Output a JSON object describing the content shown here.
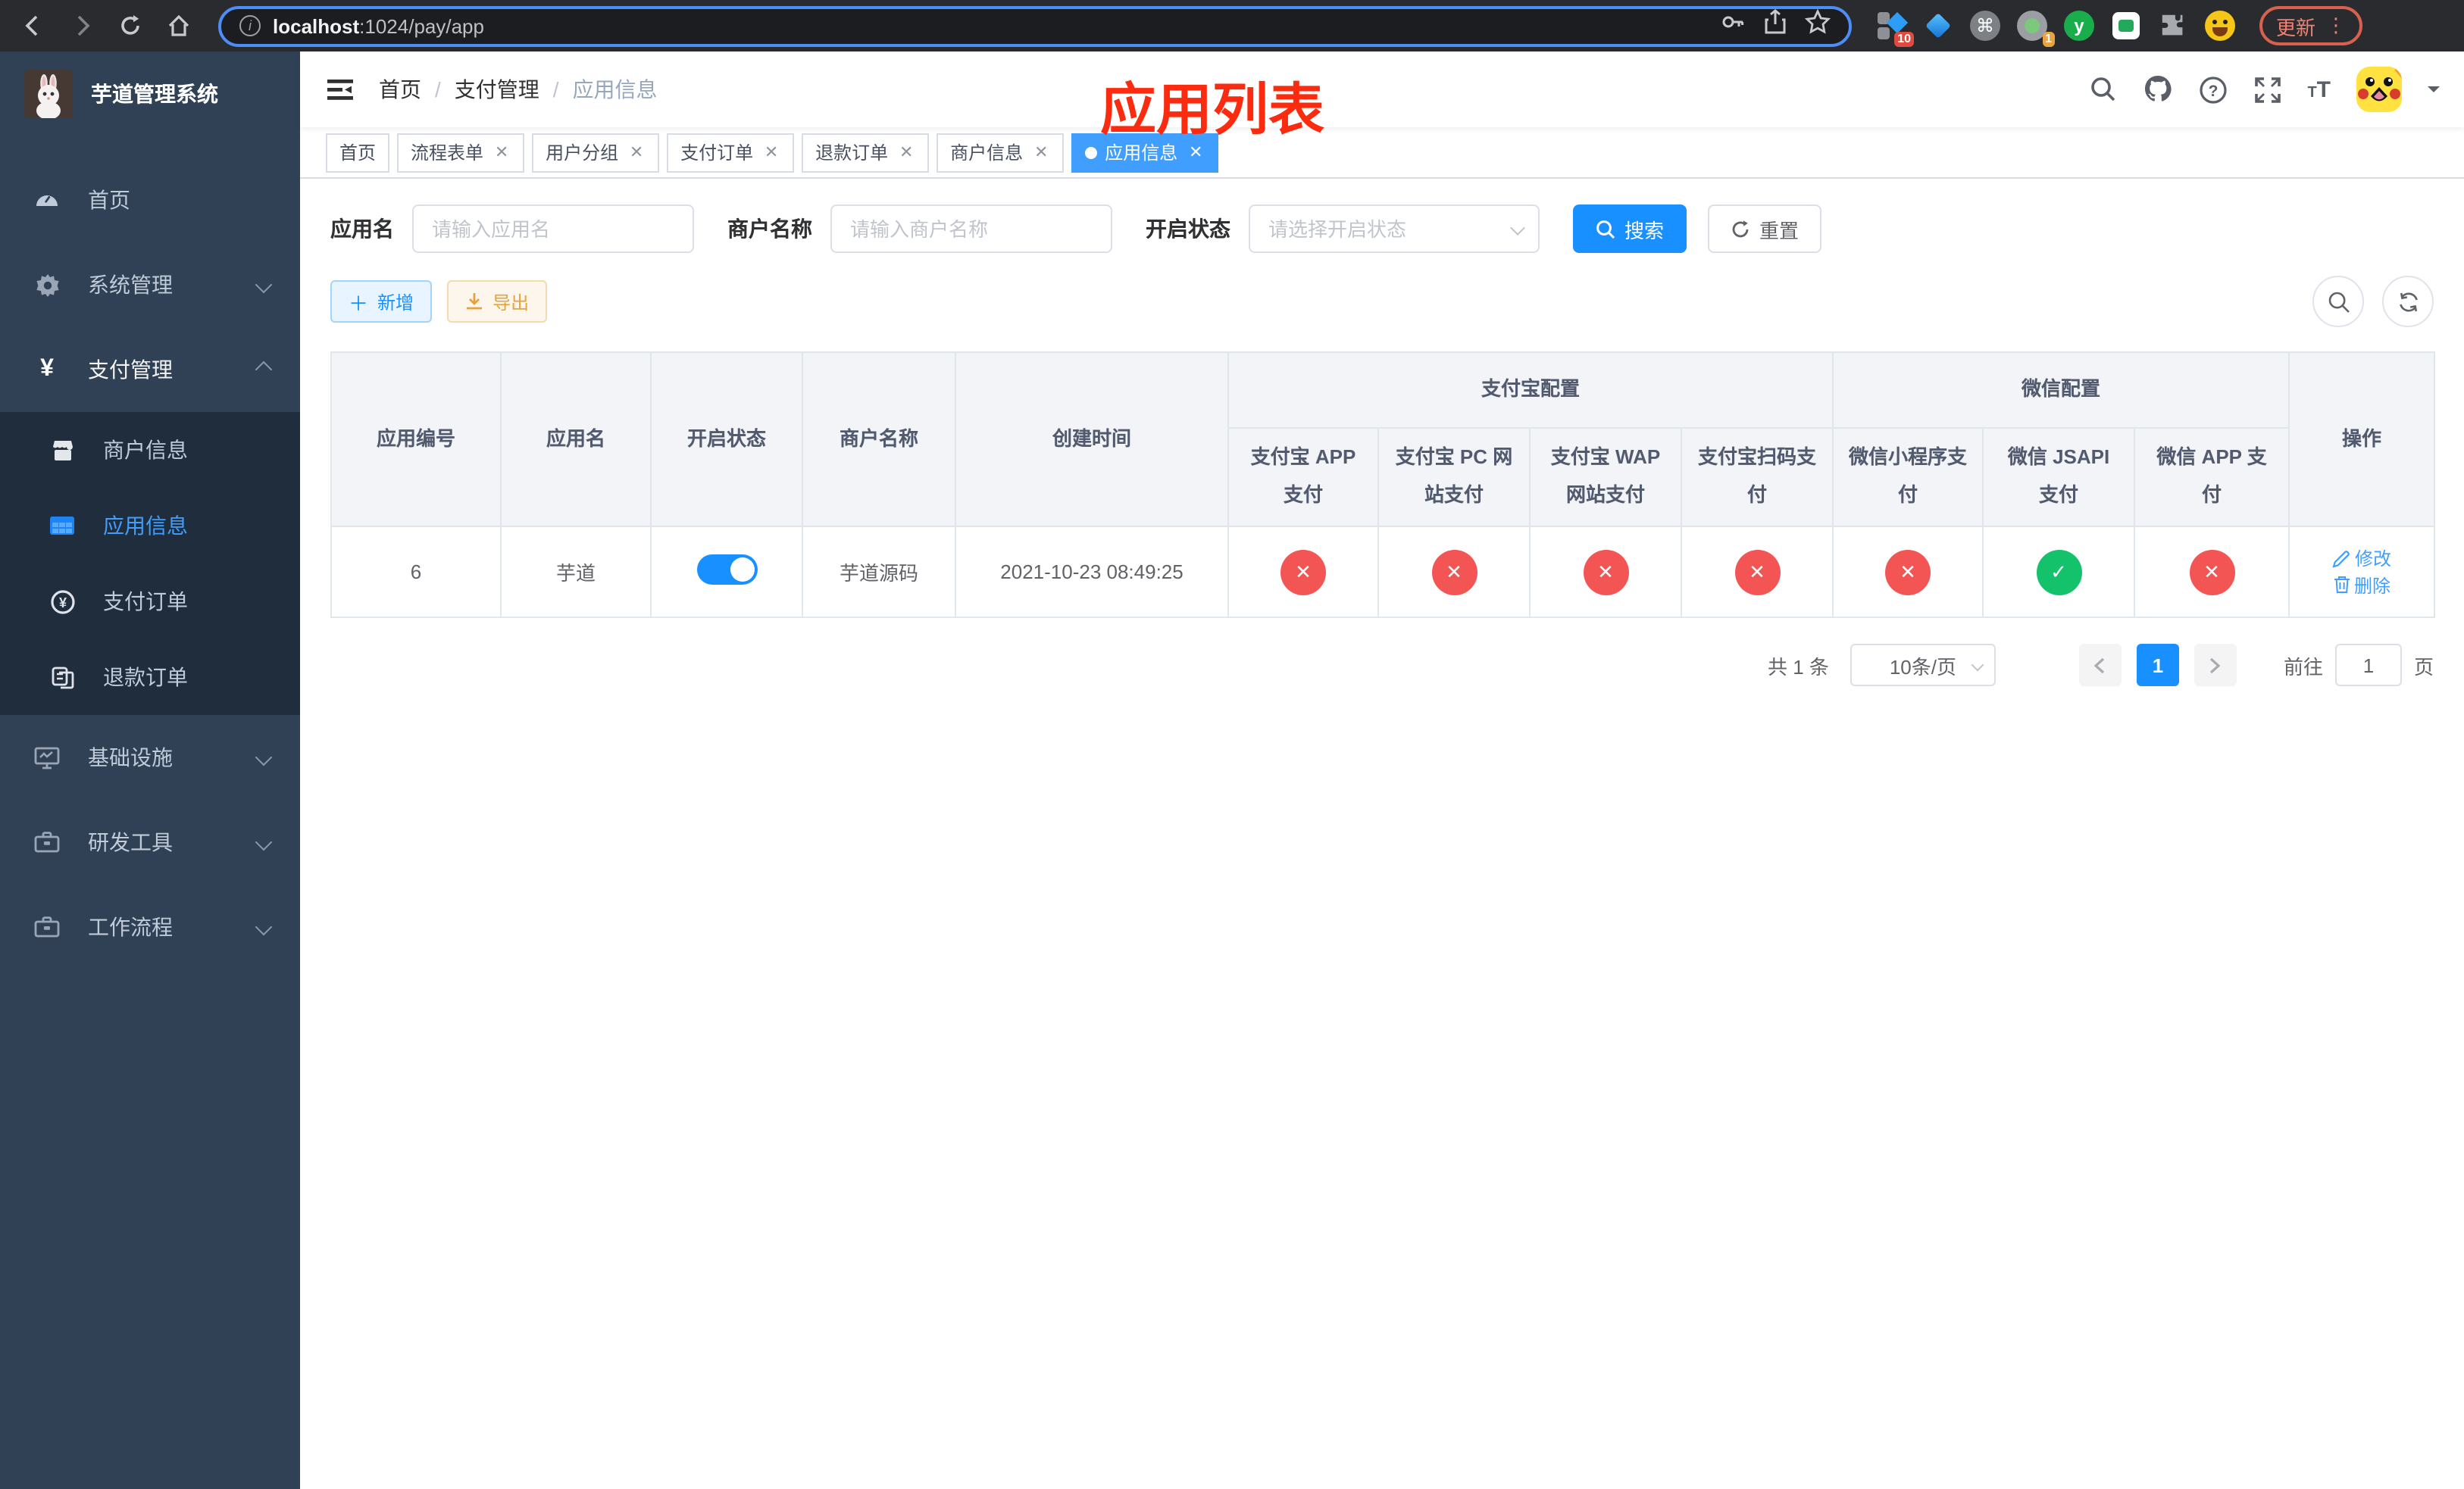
{
  "browser": {
    "url_host": "localhost",
    "url_path": ":1024/pay/app",
    "ext_badge_10": "10",
    "ext_badge_1": "1",
    "ext_y_label": "y",
    "cmd_glyph": "⌘",
    "update_label": "更新"
  },
  "sidebar": {
    "title": "芋道管理系统",
    "items": {
      "home": {
        "label": "首页"
      },
      "system": {
        "label": "系统管理"
      },
      "payment": {
        "label": "支付管理"
      },
      "merchant": {
        "label": "商户信息"
      },
      "app": {
        "label": "应用信息"
      },
      "pay_order": {
        "label": "支付订单"
      },
      "refund_order": {
        "label": "退款订单"
      },
      "infra": {
        "label": "基础设施"
      },
      "devtools": {
        "label": "研发工具"
      },
      "workflow": {
        "label": "工作流程"
      }
    }
  },
  "header": {
    "breadcrumb": [
      "首页",
      "支付管理",
      "应用信息"
    ],
    "overlay_title": "应用列表"
  },
  "tabs": [
    {
      "label": "首页",
      "closable": false,
      "active": false
    },
    {
      "label": "流程表单",
      "closable": true,
      "active": false
    },
    {
      "label": "用户分组",
      "closable": true,
      "active": false
    },
    {
      "label": "支付订单",
      "closable": true,
      "active": false
    },
    {
      "label": "退款订单",
      "closable": true,
      "active": false
    },
    {
      "label": "商户信息",
      "closable": true,
      "active": false
    },
    {
      "label": "应用信息",
      "closable": true,
      "active": true
    }
  ],
  "filters": {
    "app_name": {
      "label": "应用名",
      "placeholder": "请输入应用名"
    },
    "merchant_name": {
      "label": "商户名称",
      "placeholder": "请输入商户名称"
    },
    "status": {
      "label": "开启状态",
      "placeholder": "请选择开启状态"
    },
    "search_label": "搜索",
    "reset_label": "重置"
  },
  "toolbar": {
    "add_label": "新增",
    "export_label": "导出"
  },
  "table": {
    "headers": {
      "app_id": "应用编号",
      "app_name": "应用名",
      "status": "开启状态",
      "merchant_name": "商户名称",
      "created_at": "创建时间",
      "alipay_group": "支付宝配置",
      "wechat_group": "微信配置",
      "alipay_app": "支付宝 APP 支付",
      "alipay_pc": "支付宝 PC 网站支付",
      "alipay_wap": "支付宝 WAP 网站支付",
      "alipay_qr": "支付宝扫码支付",
      "wechat_mini": "微信小程序支付",
      "wechat_jsapi": "微信 JSAPI 支付",
      "wechat_app": "微信 APP 支付",
      "actions": "操作"
    },
    "status_glyphs": {
      "pass": "✓",
      "fail": "✕"
    },
    "row": {
      "id": "6",
      "name": "芋道",
      "enabled": true,
      "merchant": "芋道源码",
      "created_at": "2021-10-23 08:49:25",
      "statuses": [
        false,
        false,
        false,
        false,
        false,
        true,
        false
      ],
      "edit_label": "修改",
      "delete_label": "删除"
    }
  },
  "pagination": {
    "total": "共 1 条",
    "page_size": "10条/页",
    "current": "1",
    "goto_label": "前往",
    "goto_value": "1",
    "page_label": "页"
  }
}
